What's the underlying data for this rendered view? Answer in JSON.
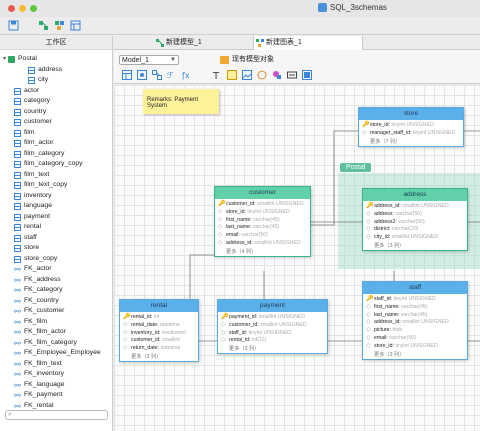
{
  "window": {
    "title": "SQL_3schemas"
  },
  "sidebar": {
    "header": "工作区",
    "tree": [
      {
        "label": "Postal",
        "type": "schema",
        "indent": 0
      },
      {
        "label": "address",
        "type": "table",
        "indent": 1
      },
      {
        "label": "city",
        "type": "table",
        "indent": 1
      },
      {
        "label": "actor",
        "type": "table",
        "indent": 0
      },
      {
        "label": "category",
        "type": "table",
        "indent": 0
      },
      {
        "label": "country",
        "type": "table",
        "indent": 0
      },
      {
        "label": "customer",
        "type": "table",
        "indent": 0
      },
      {
        "label": "film",
        "type": "table",
        "indent": 0
      },
      {
        "label": "film_actor",
        "type": "table",
        "indent": 0
      },
      {
        "label": "film_category",
        "type": "table",
        "indent": 0
      },
      {
        "label": "film_category_copy",
        "type": "table",
        "indent": 0
      },
      {
        "label": "film_text",
        "type": "table",
        "indent": 0
      },
      {
        "label": "film_text_copy",
        "type": "table",
        "indent": 0
      },
      {
        "label": "inventory",
        "type": "table",
        "indent": 0
      },
      {
        "label": "language",
        "type": "table",
        "indent": 0
      },
      {
        "label": "payment",
        "type": "table",
        "indent": 0
      },
      {
        "label": "rental",
        "type": "table",
        "indent": 0
      },
      {
        "label": "staff",
        "type": "table",
        "indent": 0
      },
      {
        "label": "store",
        "type": "table",
        "indent": 0
      },
      {
        "label": "store_copy",
        "type": "table",
        "indent": 0
      },
      {
        "label": "FK_actor",
        "type": "fk",
        "indent": 0
      },
      {
        "label": "FK_address",
        "type": "fk",
        "indent": 0
      },
      {
        "label": "FK_category",
        "type": "fk",
        "indent": 0
      },
      {
        "label": "FK_country",
        "type": "fk",
        "indent": 0
      },
      {
        "label": "FK_customer",
        "type": "fk",
        "indent": 0
      },
      {
        "label": "FK_film",
        "type": "fk",
        "indent": 0
      },
      {
        "label": "FK_film_actor",
        "type": "fk",
        "indent": 0
      },
      {
        "label": "FK_film_category",
        "type": "fk",
        "indent": 0
      },
      {
        "label": "FK_Employee_Employee",
        "type": "fk",
        "indent": 0
      },
      {
        "label": "FK_film_text",
        "type": "fk",
        "indent": 0
      },
      {
        "label": "FK_inventory",
        "type": "fk",
        "indent": 0
      },
      {
        "label": "FK_language",
        "type": "fk",
        "indent": 0
      },
      {
        "label": "FK_payment",
        "type": "fk",
        "indent": 0
      },
      {
        "label": "FK_rental",
        "type": "fk",
        "indent": 0
      }
    ]
  },
  "tabs": [
    {
      "label": "新建模型_1",
      "active": false
    },
    {
      "label": "新建图表_1",
      "active": true
    }
  ],
  "designer": {
    "model_select": "Model_1",
    "existing_objects": "现有模型对象"
  },
  "canvas": {
    "note": "Remarks: Payment System",
    "layer_label": "Postal",
    "entities": {
      "store": {
        "name": "store",
        "color": "blue",
        "fields": [
          {
            "key": true,
            "name": "store_id",
            "type": "tinyint UNSIGNED"
          },
          {
            "key": false,
            "name": "manager_staff_id",
            "type": "tinyint UNSIGNED"
          }
        ],
        "more": "更多（7 列）"
      },
      "customer": {
        "name": "customer",
        "color": "green",
        "fields": [
          {
            "key": true,
            "name": "customer_id",
            "type": "smallint UNSIGNED"
          },
          {
            "key": false,
            "name": "store_id",
            "type": "tinyint UNSIGNED"
          },
          {
            "key": false,
            "name": "first_name",
            "type": "varchar(45)"
          },
          {
            "key": false,
            "name": "last_name",
            "type": "varchar(45)"
          },
          {
            "key": false,
            "name": "email",
            "type": "varchar(50)"
          },
          {
            "key": false,
            "name": "address_id",
            "type": "smallint UNSIGNED"
          }
        ],
        "more": "更多（4 列）"
      },
      "address": {
        "name": "address",
        "color": "green",
        "fields": [
          {
            "key": true,
            "name": "address_id",
            "type": "smallint UNSIGNED"
          },
          {
            "key": false,
            "name": "address",
            "type": "varchar(50)"
          },
          {
            "key": false,
            "name": "address2",
            "type": "varchar(50)"
          },
          {
            "key": false,
            "name": "district",
            "type": "varchar(20)"
          },
          {
            "key": false,
            "name": "city_id",
            "type": "smallint UNSIGNED"
          }
        ],
        "more": "更多（3 列）"
      },
      "rental": {
        "name": "rental",
        "color": "blue",
        "fields": [
          {
            "key": true,
            "name": "rental_id",
            "type": "int"
          },
          {
            "key": false,
            "name": "rental_date",
            "type": "datetime"
          },
          {
            "key": false,
            "name": "inventory_id",
            "type": "mediumint"
          },
          {
            "key": false,
            "name": "customer_id",
            "type": "smallint"
          },
          {
            "key": false,
            "name": "return_date",
            "type": "datetime"
          }
        ],
        "more": "更多（2 列）"
      },
      "payment": {
        "name": "payment",
        "color": "blue",
        "fields": [
          {
            "key": true,
            "name": "payment_id",
            "type": "smallint UNSIGNED"
          },
          {
            "key": false,
            "name": "customer_id",
            "type": "smallint UNSIGNED"
          },
          {
            "key": false,
            "name": "staff_id",
            "type": "tinyint UNSIGNED"
          },
          {
            "key": false,
            "name": "rental_id",
            "type": "int(11)"
          }
        ],
        "more": "更多（3 列）"
      },
      "staff": {
        "name": "staff",
        "color": "blue",
        "fields": [
          {
            "key": true,
            "name": "staff_id",
            "type": "tinyint UNSIGNED"
          },
          {
            "key": false,
            "name": "first_name",
            "type": "varchar(45)"
          },
          {
            "key": false,
            "name": "last_name",
            "type": "varchar(45)"
          },
          {
            "key": false,
            "name": "address_id",
            "type": "smallint UNSIGNED"
          },
          {
            "key": false,
            "name": "picture",
            "type": "blob"
          },
          {
            "key": false,
            "name": "email",
            "type": "varchar(50)"
          },
          {
            "key": false,
            "name": "store_id",
            "type": "tinyint UNSIGNED"
          }
        ],
        "more": "更多（3 列）"
      }
    }
  }
}
